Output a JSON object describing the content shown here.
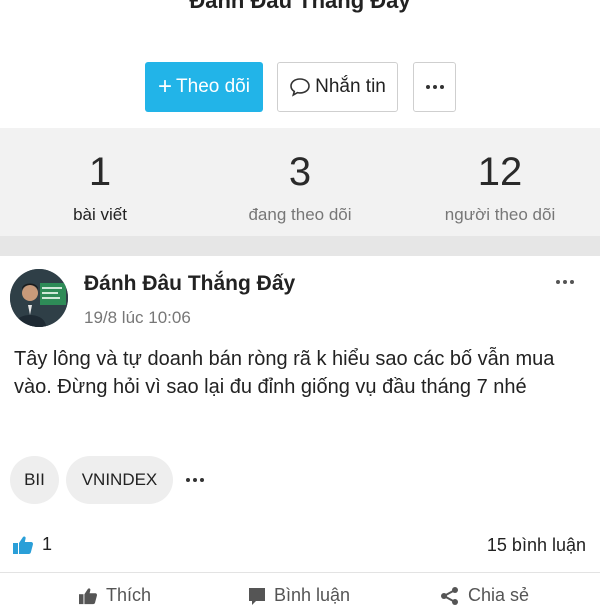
{
  "profile": {
    "name": "Đánh Đâu Thắng Đấy"
  },
  "buttons": {
    "follow_plus": "+",
    "follow_label": "Theo dõi",
    "message_label": "Nhắn tin"
  },
  "stats": [
    {
      "value": "1",
      "label": "bài viết"
    },
    {
      "value": "3",
      "label": "đang theo dõi"
    },
    {
      "value": "12",
      "label": "người theo dõi"
    }
  ],
  "post": {
    "author": "Đánh Đâu Thắng Đấy",
    "timestamp": "19/8 lúc 10:06",
    "content": "Tây lông và tự doanh bán ròng rã k hiểu sao các bố vẫn mua vào. Đừng hỏi vì sao lại đu đỉnh giống vụ đầu tháng 7 nhé",
    "tags": [
      "BII",
      "VNINDEX"
    ],
    "like_count": "1",
    "comment_count": "15 bình luận",
    "actions": [
      "Thích",
      "Bình luận",
      "Chia sẻ"
    ]
  },
  "colors": {
    "accent": "#22b4e8",
    "stats_background": "#f2f2f2",
    "tag_background": "#eeeeee"
  },
  "icons": {
    "message": "chat-bubble-icon",
    "more": "more-dots-icon",
    "like": "thumbs-up-icon",
    "comment": "comment-icon",
    "share": "share-icon"
  }
}
